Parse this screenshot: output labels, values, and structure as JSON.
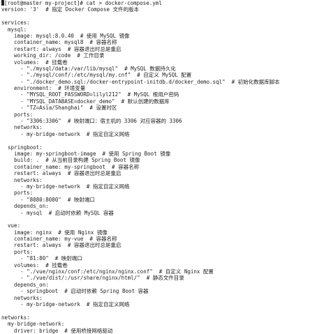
{
  "terminal": {
    "prompt_line": "[root@master my-project]# cat > docker-compose.yml",
    "lines": [
      "version: '3'  # 指定 Docker Compose 文件的版本",
      "",
      "services:",
      "  mysql:",
      "    image: mysql:8.0.40  # 使用 MySQL 镜像",
      "    container_name: mysql8  # 容器名称",
      "    restart: always  # 容器退出时总是重启",
      "    working_dir: /code  # 工作目录",
      "    volumes:  # 挂载卷",
      "      - \"./mysql/data:/var/lib/mysql\"  # MySQL 数据持久化",
      "      - \"./mysql/conf/:/etc/mysql/my.cnf\"  # 自定义 MySQL 配置",
      "      - \"./docker_demo.sql:/docker-entrypoint-initdb.d/docker_demo.sql\"  # 初始化数据库脚本",
      "    environment:  # 环境变量",
      "      - \"MYSQL_ROOT_PASSWORD=lilyl212\"  # MySQL 根用户密码",
      "      - \"MYSQL_DATABASE=docker_demo\"  # 默认创建的数据库",
      "      - \"TZ=Asia/Shanghai\"  # 设置时区",
      "    ports:",
      "      - \"3306:3306\"  # 映射端口：宿主机的 3306 对应容器的 3306",
      "    networks:",
      "      - my-bridge-network  # 指定自定义网络",
      "",
      "  springboot:",
      "    image: my-springboot-image  # 使用 Spring Boot 镜像",
      "    build: .  # 从当前目录构建 Spring Boot 镜像",
      "    container_name: my-springboot  # 容器名称",
      "    restart: always  # 容器退出时总是重启",
      "    networks:",
      "      - my-bridge-network  # 指定自定义网络",
      "    ports:",
      "      - \"8080:8080\"  # 映射端口",
      "    depends_on:",
      "      - mysql  # 启动时依赖 MySQL 容器",
      "",
      "  vue:",
      "    image: nginx  # 使用 Nginx 镜像",
      "    container_name: my-vue  # 容器名称",
      "    restart: always  # 容器退出时总是重启",
      "    ports:",
      "      - \"81:80\"  # 映射端口",
      "    volumes:  # 挂载卷",
      "      - \"./vue/nginx/conf:/etc/nginx/nginx.conf\"  # 自定义 Nginx 配置",
      "      - \"./vue/dist/:/usr/share/nginx/html/\"  # 静态文件目录",
      "    depends_on:",
      "      - springboot  # 启动时依赖 Spring Boot 容器",
      "    networks:",
      "      - my-bridge-network  # 指定自定义网络",
      "",
      "networks:",
      "  my-bridge-network:",
      "    driver: bridge  # 使用桥接网络驱动"
    ]
  }
}
